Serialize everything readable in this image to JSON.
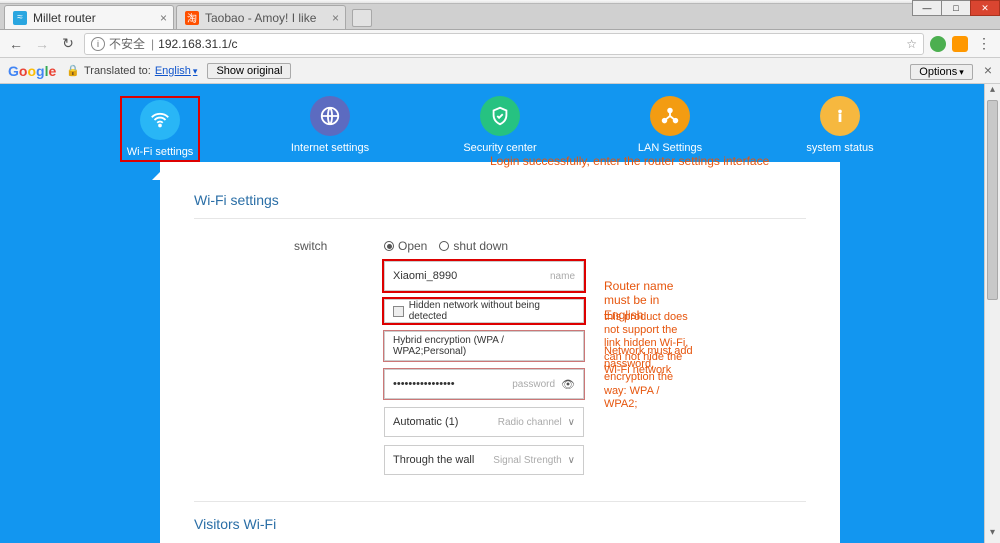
{
  "window": {
    "tabs": [
      {
        "title": "Millet router",
        "favicon_bg": "#2aa6e0",
        "favicon_txt": "≈"
      },
      {
        "title": "Taobao - Amoy! I like",
        "favicon_bg": "#ff5000",
        "favicon_txt": "淘"
      }
    ]
  },
  "omnibox": {
    "insecure_label": "不安全",
    "url": "192.168.31.1/c"
  },
  "translate": {
    "translated_to_label": "Translated to:",
    "language": "English",
    "show_original": "Show original",
    "options": "Options",
    "close": "×"
  },
  "nav": {
    "items": [
      {
        "label": "Wi-Fi settings"
      },
      {
        "label": "Internet settings"
      },
      {
        "label": "Security center"
      },
      {
        "label": "LAN Settings"
      },
      {
        "label": "system status"
      }
    ]
  },
  "card": {
    "title": "Wi-Fi settings",
    "visitors_title": "Visitors Wi-Fi",
    "switch_label": "switch",
    "radio_open": "Open",
    "radio_shutdown": "shut down",
    "name_value": "Xiaomi_8990",
    "name_suffix": "name",
    "hidden_label": "Hidden network without being detected",
    "encryption_value": "Hybrid encryption (WPA / WPA2;Personal)",
    "password_value": "••••••••••••••••",
    "password_suffix": "password",
    "radio_channel_value": "Automatic (1)",
    "radio_channel_suffix": "Radio channel",
    "signal_value": "Through the wall",
    "signal_suffix": "Signal Strength"
  },
  "annotations": {
    "login": "Login successfully, enter the router settings interface",
    "name": "Router name must be in English",
    "hidden": "this product does not support the link hidden Wi-Fi,\ncan not hide the Wi-Fi network",
    "encryption": "Network must add password,\nencryption the way: WPA / WPA2;"
  }
}
